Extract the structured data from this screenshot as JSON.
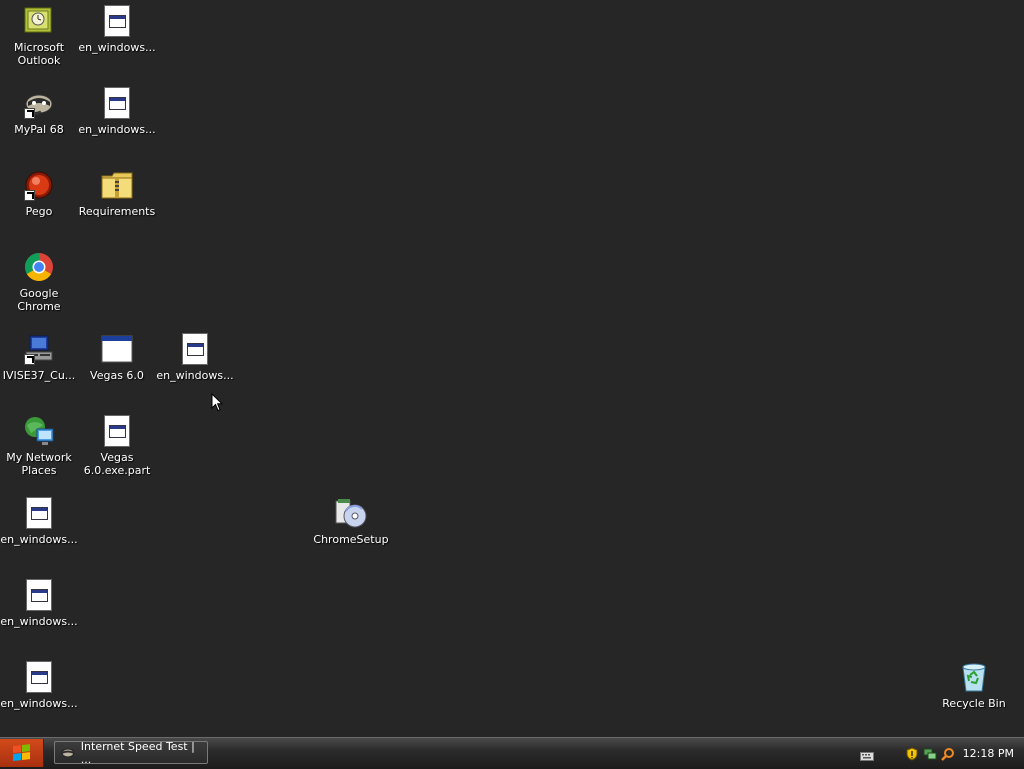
{
  "desktop": {
    "icons": {
      "outlook": "Microsoft\nOutlook",
      "mypal": "MyPal 68",
      "pego": "Pego",
      "chrome": "Google Chrome",
      "ivise": "IVISE37_Cu...",
      "network": "My Network\nPlaces",
      "enwin_1": "en_windows...",
      "enwin_2": "en_windows...",
      "enwin_3": "en_windows...",
      "enwin_4": "en_windows...",
      "enwin_5": "en_windows...",
      "enwin_6": "en_windows...",
      "requirements": "Requirements",
      "vegas": "Vegas 6.0",
      "vegas_part": "Vegas\n6.0.exe.part",
      "chromesetup": "ChromeSetup",
      "recycle": "Recycle Bin"
    }
  },
  "taskbar": {
    "active_task": "Internet Speed Test | ...",
    "clock": "12:18 PM"
  }
}
